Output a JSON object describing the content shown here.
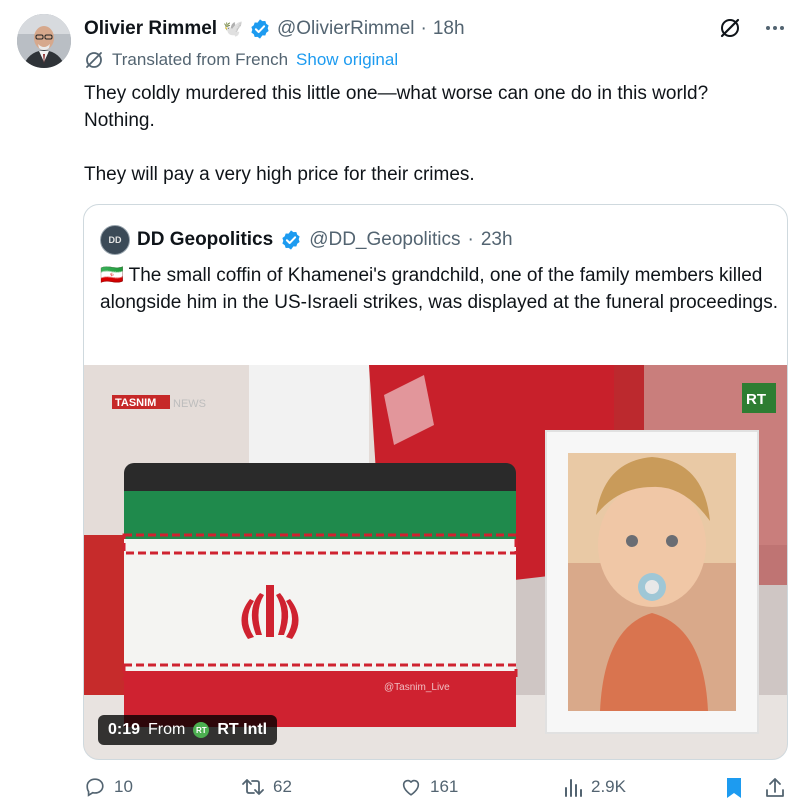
{
  "post": {
    "author_name": "Olivier Rimmel",
    "author_emoji": "🕊️",
    "handle": "@OlivierRimmel",
    "separator": "·",
    "time": "18h",
    "translated_label": "Translated from French",
    "show_original_label": "Show original",
    "text_lines": [
      "They coldly murdered this little one—what worse can one do in this world?",
      "Nothing.",
      "They will pay a very high price for their crimes."
    ]
  },
  "quote": {
    "author_name": "DD Geopolitics",
    "handle": "@DD_Geopolitics",
    "separator": "·",
    "time": "23h",
    "avatar_text": "DD",
    "flag_emoji": "🇮🇷",
    "text": "The small coffin of Khamenei's grandchild, one of the family members killed alongside him in the US-Israeli strikes, was displayed at the funeral proceedings.",
    "video": {
      "duration": "0:19",
      "from_label": "From",
      "source": "RT Intl",
      "source_badge": "RT",
      "watermark_tasnim": "TASNIM",
      "watermark_news": "NEWS",
      "watermark_rt": "RT",
      "watermark_handle": "@Tasnim_Live"
    }
  },
  "actions": {
    "replies": "10",
    "reposts": "62",
    "likes": "161",
    "views": "2.9K"
  },
  "colors": {
    "accent": "#1d9bf0",
    "muted": "#536471",
    "bookmark": "#1d9bf0",
    "verified": "#1d9bf0"
  }
}
